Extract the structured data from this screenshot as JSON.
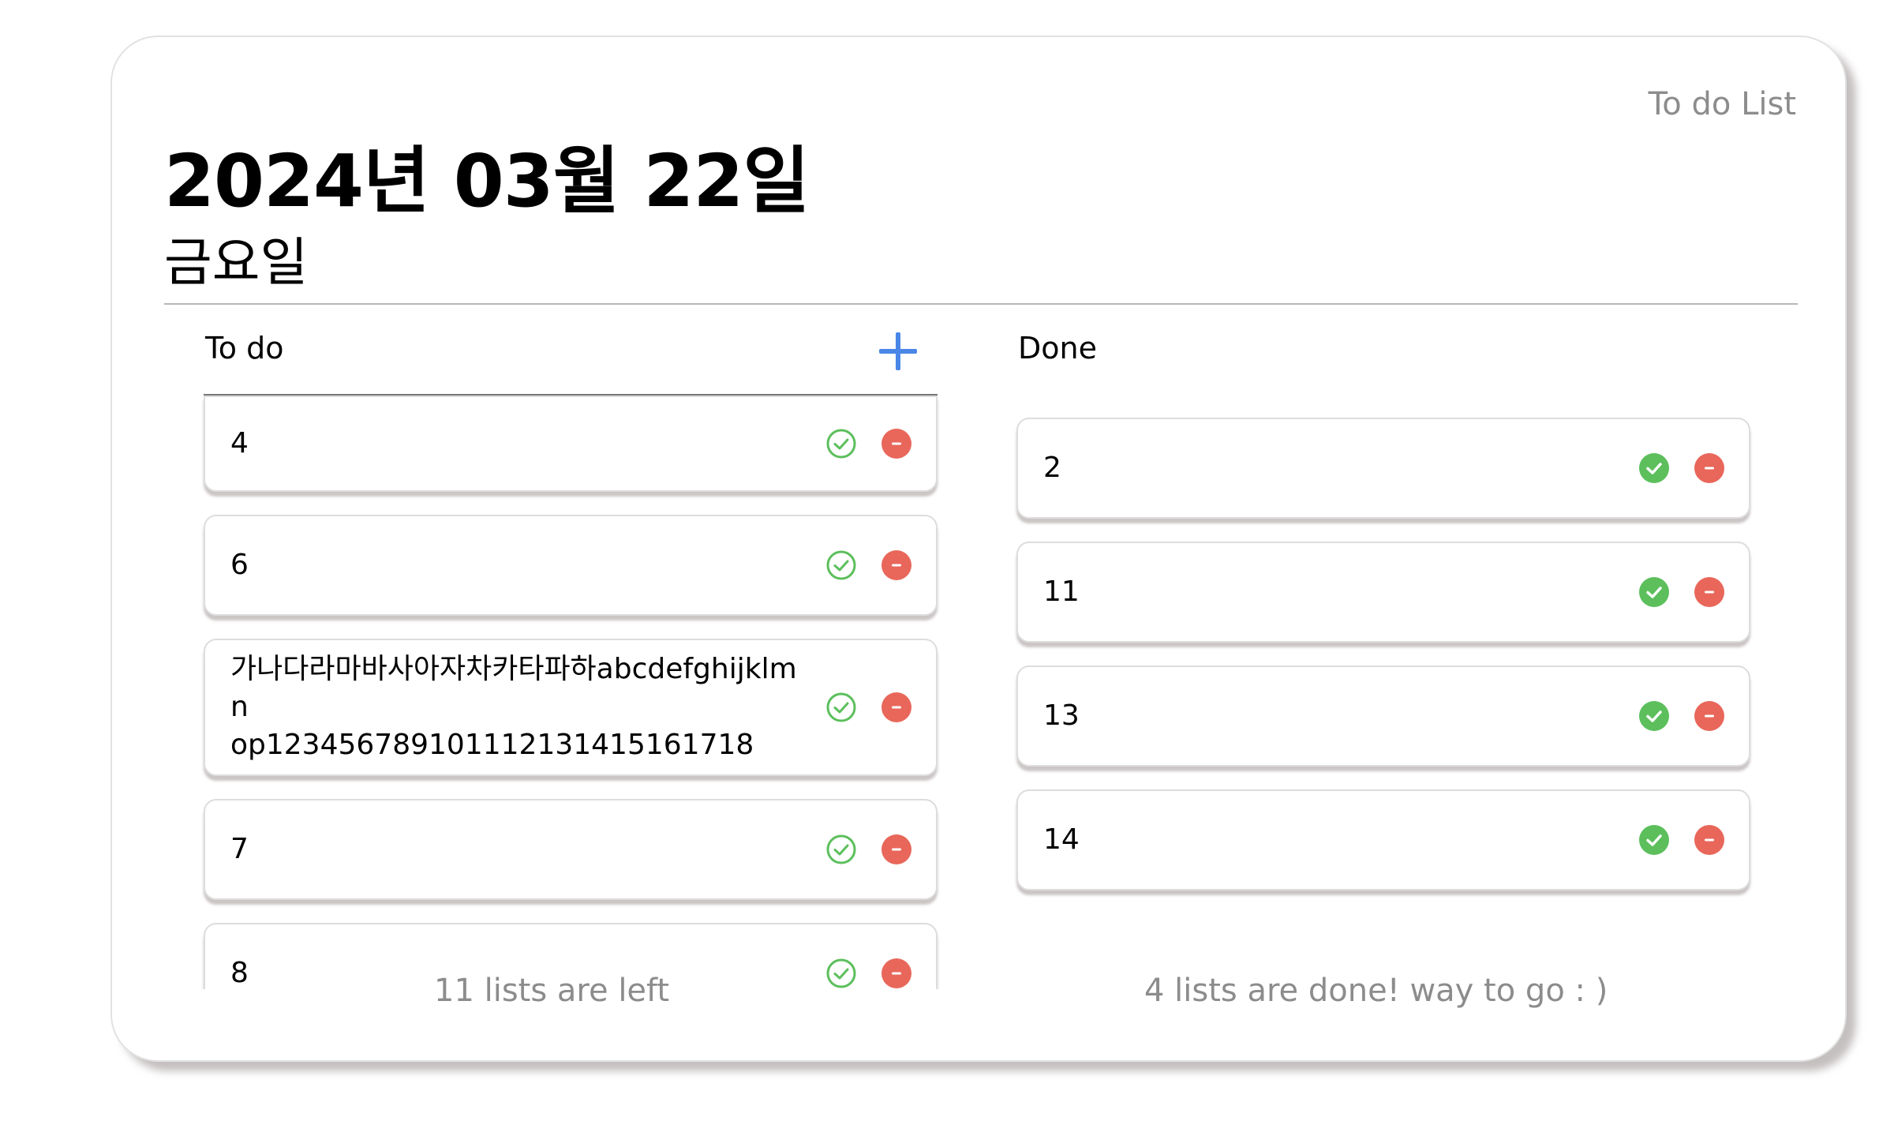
{
  "app_title": "To do List",
  "date_title": "2024년 03월 22일",
  "weekday": "금요일",
  "todo": {
    "title": "To do",
    "add_icon": "plus-icon",
    "items": [
      {
        "text": "4"
      },
      {
        "text": "6"
      },
      {
        "text": "가나다라마바사아자차카타파하abcdefghijklmn\nop123456789101112131415161718"
      },
      {
        "text": "7"
      },
      {
        "text": "8"
      }
    ],
    "footer": "11 lists are left"
  },
  "done": {
    "title": "Done",
    "items": [
      {
        "text": "2"
      },
      {
        "text": "11"
      },
      {
        "text": "13"
      },
      {
        "text": "14"
      }
    ],
    "footer": "4 lists are done! way to go : )"
  },
  "colors": {
    "accent_blue": "#4a86e8",
    "check_green": "#5cbf5c",
    "delete_red": "#e8675a",
    "muted_text": "#8c8c8c"
  },
  "icons": {
    "check_outline": "check-circle-outline-icon",
    "check_filled": "check-circle-filled-icon",
    "delete": "minus-circle-icon"
  }
}
